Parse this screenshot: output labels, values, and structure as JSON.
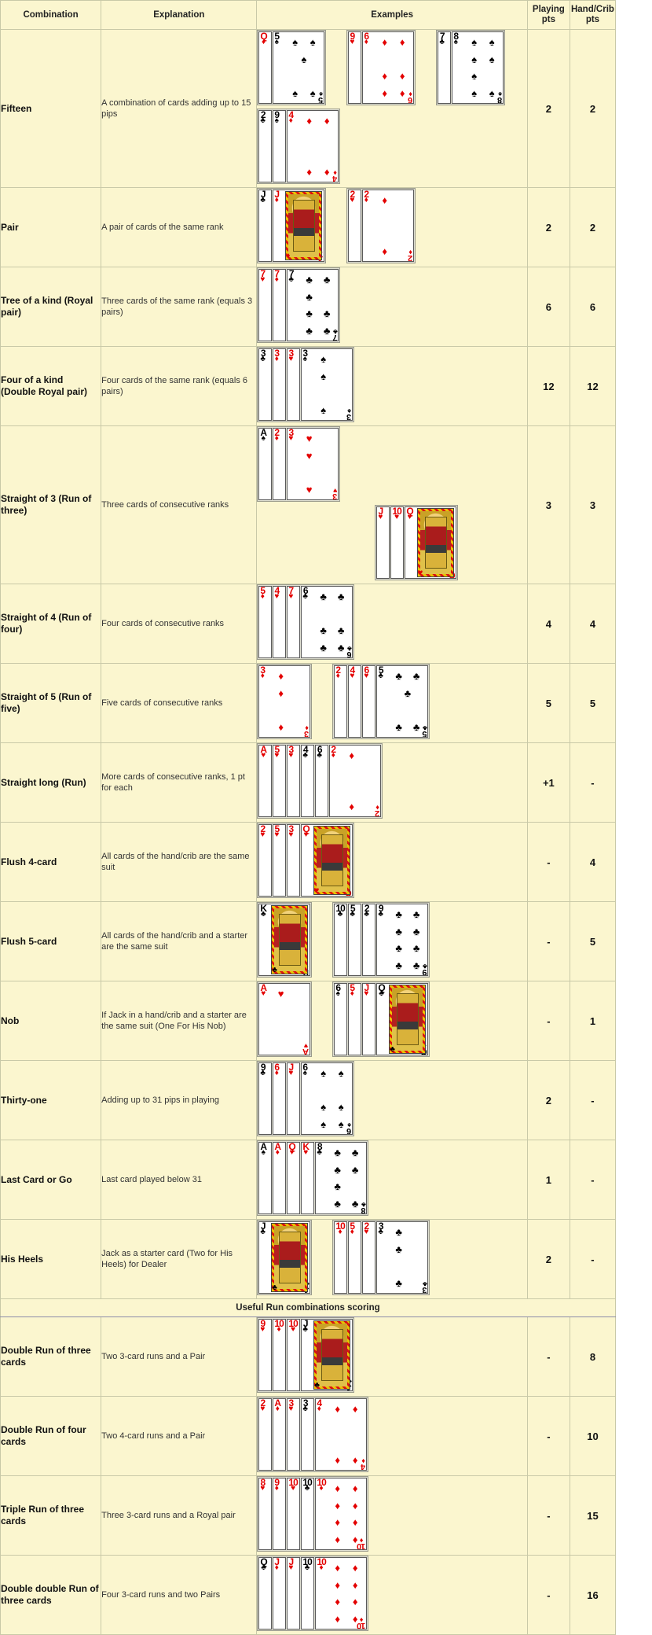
{
  "table": {
    "headers": [
      "Combination",
      "Explanation",
      "Examples",
      "Playing pts",
      "Hand/Crib pts"
    ],
    "header_playing_line1": "Playing",
    "header_playing_line2": "pts",
    "header_hand_line1": "Hand/Crib",
    "header_hand_line2": "pts",
    "section_title": "Useful Run combinations scoring",
    "colors": {
      "header_bg": "#f8f09a",
      "cell_bg": "#fbf6cf",
      "grid": "#c9c9a8",
      "outer_border": "#8c8ca8",
      "red_suit": "#e30000",
      "black_suit": "#000000"
    },
    "rows": [
      {
        "combination": "Fifteen",
        "explanation": "A combination of cards adding up to 15 pips",
        "playing_pts": "2",
        "hand_crib_pts": "2",
        "hands": [
          {
            "cards": [
              {
                "rank": "Q",
                "suit": "♦",
                "color": "red",
                "face": true
              },
              {
                "rank": "5",
                "suit": "♠",
                "color": "black"
              }
            ]
          },
          {
            "cards": [
              {
                "rank": "9",
                "suit": "♥",
                "color": "red"
              },
              {
                "rank": "6",
                "suit": "♦",
                "color": "red"
              }
            ]
          },
          {
            "cards": [
              {
                "rank": "7",
                "suit": "♣",
                "color": "black"
              },
              {
                "rank": "8",
                "suit": "♠",
                "color": "black"
              }
            ]
          },
          {
            "cards": [
              {
                "rank": "2",
                "suit": "♣",
                "color": "black"
              },
              {
                "rank": "9",
                "suit": "♠",
                "color": "black"
              },
              {
                "rank": "4",
                "suit": "♦",
                "color": "red"
              }
            ],
            "newline": true
          }
        ]
      },
      {
        "combination": "Pair",
        "explanation": "A pair of cards of the same rank",
        "playing_pts": "2",
        "hand_crib_pts": "2",
        "hands": [
          {
            "cards": [
              {
                "rank": "J",
                "suit": "♣",
                "color": "black",
                "face": true
              },
              {
                "rank": "J",
                "suit": "♦",
                "color": "red",
                "face": true
              }
            ]
          },
          {
            "cards": [
              {
                "rank": "2",
                "suit": "♥",
                "color": "red"
              },
              {
                "rank": "2",
                "suit": "♦",
                "color": "red"
              }
            ]
          }
        ]
      },
      {
        "combination": "Tree of a kind (Royal pair)",
        "explanation": "Three cards of the same rank (equals 3 pairs)",
        "playing_pts": "6",
        "hand_crib_pts": "6",
        "hands": [
          {
            "cards": [
              {
                "rank": "7",
                "suit": "♥",
                "color": "red"
              },
              {
                "rank": "7",
                "suit": "♦",
                "color": "red"
              },
              {
                "rank": "7",
                "suit": "♣",
                "color": "black"
              }
            ]
          }
        ]
      },
      {
        "combination": "Four of a kind (Double Royal pair)",
        "explanation": "Four cards of the same rank (equals 6 pairs)",
        "playing_pts": "12",
        "hand_crib_pts": "12",
        "hands": [
          {
            "cards": [
              {
                "rank": "3",
                "suit": "♣",
                "color": "black"
              },
              {
                "rank": "3",
                "suit": "♦",
                "color": "red"
              },
              {
                "rank": "3",
                "suit": "♥",
                "color": "red"
              },
              {
                "rank": "3",
                "suit": "♠",
                "color": "black"
              }
            ]
          }
        ]
      },
      {
        "combination": "Straight of 3 (Run of three)",
        "explanation": "Three cards of consecutive ranks",
        "playing_pts": "3",
        "hand_crib_pts": "3",
        "hands": [
          {
            "cards": [
              {
                "rank": "A",
                "suit": "♠",
                "color": "black"
              },
              {
                "rank": "2",
                "suit": "♦",
                "color": "red"
              },
              {
                "rank": "3",
                "suit": "♥",
                "color": "red"
              }
            ]
          },
          {
            "cards": [
              {
                "rank": "J",
                "suit": "♥",
                "color": "red",
                "face": true
              },
              {
                "rank": "10",
                "suit": "♥",
                "color": "red"
              },
              {
                "rank": "Q",
                "suit": "♥",
                "color": "red",
                "face": true
              }
            ],
            "offset": true
          }
        ]
      },
      {
        "combination": "Straight of 4 (Run of four)",
        "explanation": "Four cards of consecutive ranks",
        "playing_pts": "4",
        "hand_crib_pts": "4",
        "hands": [
          {
            "cards": [
              {
                "rank": "5",
                "suit": "♦",
                "color": "red"
              },
              {
                "rank": "4",
                "suit": "♥",
                "color": "red"
              },
              {
                "rank": "7",
                "suit": "♥",
                "color": "red"
              },
              {
                "rank": "6",
                "suit": "♣",
                "color": "black"
              }
            ]
          }
        ]
      },
      {
        "combination": "Straight of 5 (Run of five)",
        "explanation": "Five cards of consecutive ranks",
        "playing_pts": "5",
        "hand_crib_pts": "5",
        "hands": [
          {
            "cards": [
              {
                "rank": "3",
                "suit": "♦",
                "color": "red"
              }
            ]
          },
          {
            "cards": [
              {
                "rank": "2",
                "suit": "♦",
                "color": "red"
              },
              {
                "rank": "4",
                "suit": "♥",
                "color": "red"
              },
              {
                "rank": "6",
                "suit": "♥",
                "color": "red"
              },
              {
                "rank": "5",
                "suit": "♣",
                "color": "black"
              }
            ]
          }
        ]
      },
      {
        "combination": "Straight long (Run)",
        "explanation": "More cards of consecutive ranks, 1 pt for each",
        "playing_pts": "+1",
        "hand_crib_pts": "-",
        "hands": [
          {
            "cards": [
              {
                "rank": "A",
                "suit": "♥",
                "color": "red"
              },
              {
                "rank": "5",
                "suit": "♥",
                "color": "red"
              },
              {
                "rank": "3",
                "suit": "♥",
                "color": "red"
              },
              {
                "rank": "4",
                "suit": "♣",
                "color": "black"
              },
              {
                "rank": "6",
                "suit": "♣",
                "color": "black"
              },
              {
                "rank": "2",
                "suit": "♦",
                "color": "red"
              }
            ]
          }
        ]
      },
      {
        "combination": "Flush 4-card",
        "explanation": "All cards of the hand/crib are the same suit",
        "playing_pts": "-",
        "hand_crib_pts": "4",
        "hands": [
          {
            "cards": [
              {
                "rank": "2",
                "suit": "♥",
                "color": "red"
              },
              {
                "rank": "5",
                "suit": "♥",
                "color": "red"
              },
              {
                "rank": "3",
                "suit": "♥",
                "color": "red"
              },
              {
                "rank": "Q",
                "suit": "♥",
                "color": "red",
                "face": true
              }
            ]
          }
        ]
      },
      {
        "combination": "Flush 5-card",
        "explanation": "All cards of the hand/crib and a starter are the same suit",
        "playing_pts": "-",
        "hand_crib_pts": "5",
        "hands": [
          {
            "cards": [
              {
                "rank": "K",
                "suit": "♣",
                "color": "black",
                "face": true
              }
            ]
          },
          {
            "cards": [
              {
                "rank": "10",
                "suit": "♣",
                "color": "black"
              },
              {
                "rank": "5",
                "suit": "♣",
                "color": "black"
              },
              {
                "rank": "2",
                "suit": "♣",
                "color": "black"
              },
              {
                "rank": "9",
                "suit": "♣",
                "color": "black"
              }
            ]
          }
        ]
      },
      {
        "combination": "Nob",
        "explanation": "If Jack in a hand/crib and a starter are the same suit (One For His Nob)",
        "playing_pts": "-",
        "hand_crib_pts": "1",
        "hands": [
          {
            "cards": [
              {
                "rank": "A",
                "suit": "♥",
                "color": "red"
              }
            ]
          },
          {
            "cards": [
              {
                "rank": "6",
                "suit": "♠",
                "color": "black"
              },
              {
                "rank": "5",
                "suit": "♦",
                "color": "red"
              },
              {
                "rank": "J",
                "suit": "♥",
                "color": "red",
                "face": true
              },
              {
                "rank": "Q",
                "suit": "♣",
                "color": "black",
                "face": true
              }
            ]
          }
        ]
      },
      {
        "combination": "Thirty-one",
        "explanation": "Adding up to 31 pips in playing",
        "playing_pts": "2",
        "hand_crib_pts": "-",
        "hands": [
          {
            "cards": [
              {
                "rank": "9",
                "suit": "♣",
                "color": "black"
              },
              {
                "rank": "6",
                "suit": "♦",
                "color": "red"
              },
              {
                "rank": "J",
                "suit": "♥",
                "color": "red",
                "face": true
              },
              {
                "rank": "6",
                "suit": "♠",
                "color": "black"
              }
            ]
          }
        ]
      },
      {
        "combination": "Last Card or Go",
        "explanation": "Last card played below 31",
        "playing_pts": "1",
        "hand_crib_pts": "-",
        "hands": [
          {
            "cards": [
              {
                "rank": "A",
                "suit": "♠",
                "color": "black"
              },
              {
                "rank": "A",
                "suit": "♦",
                "color": "red"
              },
              {
                "rank": "Q",
                "suit": "♥",
                "color": "red",
                "face": true
              },
              {
                "rank": "K",
                "suit": "♥",
                "color": "red",
                "face": true
              },
              {
                "rank": "8",
                "suit": "♣",
                "color": "black"
              }
            ]
          }
        ]
      },
      {
        "combination": "His Heels",
        "explanation": "Jack as a starter card (Two for His Heels) for Dealer",
        "playing_pts": "2",
        "hand_crib_pts": "-",
        "hands": [
          {
            "cards": [
              {
                "rank": "J",
                "suit": "♣",
                "color": "black",
                "face": true
              }
            ]
          },
          {
            "cards": [
              {
                "rank": "10",
                "suit": "♦",
                "color": "red"
              },
              {
                "rank": "5",
                "suit": "♦",
                "color": "red"
              },
              {
                "rank": "2",
                "suit": "♥",
                "color": "red"
              },
              {
                "rank": "3",
                "suit": "♣",
                "color": "black"
              }
            ]
          }
        ]
      },
      {
        "combination": "Double Run of three cards",
        "explanation": "Two 3-card runs and a Pair",
        "playing_pts": "-",
        "hand_crib_pts": "8",
        "section": "runs",
        "hands": [
          {
            "cards": [
              {
                "rank": "9",
                "suit": "♥",
                "color": "red"
              },
              {
                "rank": "10",
                "suit": "♦",
                "color": "red"
              },
              {
                "rank": "10",
                "suit": "♥",
                "color": "red"
              },
              {
                "rank": "J",
                "suit": "♣",
                "color": "black",
                "face": true
              }
            ]
          }
        ]
      },
      {
        "combination": "Double Run of four cards",
        "explanation": "Two 4-card runs and a Pair",
        "playing_pts": "-",
        "hand_crib_pts": "10",
        "section": "runs",
        "hands": [
          {
            "cards": [
              {
                "rank": "2",
                "suit": "♥",
                "color": "red"
              },
              {
                "rank": "A",
                "suit": "♦",
                "color": "red"
              },
              {
                "rank": "3",
                "suit": "♥",
                "color": "red"
              },
              {
                "rank": "3",
                "suit": "♣",
                "color": "black"
              },
              {
                "rank": "4",
                "suit": "♦",
                "color": "red"
              }
            ]
          }
        ]
      },
      {
        "combination": "Triple Run of three cards",
        "explanation": "Three 3-card runs and a Royal pair",
        "playing_pts": "-",
        "hand_crib_pts": "15",
        "section": "runs",
        "hands": [
          {
            "cards": [
              {
                "rank": "8",
                "suit": "♥",
                "color": "red"
              },
              {
                "rank": "9",
                "suit": "♦",
                "color": "red"
              },
              {
                "rank": "10",
                "suit": "♥",
                "color": "red"
              },
              {
                "rank": "10",
                "suit": "♣",
                "color": "black"
              },
              {
                "rank": "10",
                "suit": "♦",
                "color": "red"
              }
            ]
          }
        ]
      },
      {
        "combination": "Double double Run of three cards",
        "explanation": "Four 3-card runs and two Pairs",
        "playing_pts": "-",
        "hand_crib_pts": "16",
        "section": "runs",
        "hands": [
          {
            "cards": [
              {
                "rank": "Q",
                "suit": "♣",
                "color": "black",
                "face": true
              },
              {
                "rank": "J",
                "suit": "♦",
                "color": "red",
                "face": true
              },
              {
                "rank": "J",
                "suit": "♥",
                "color": "red",
                "face": true
              },
              {
                "rank": "10",
                "suit": "♣",
                "color": "black"
              },
              {
                "rank": "10",
                "suit": "♦",
                "color": "red"
              }
            ]
          }
        ]
      }
    ]
  }
}
